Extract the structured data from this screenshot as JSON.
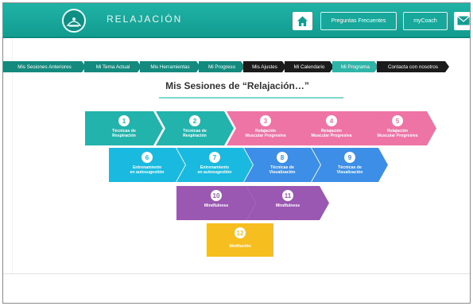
{
  "header": {
    "app_title": "RELAJACIÓN",
    "faq_label": "Preguntas Frecuentes",
    "coach_label": "myCoach",
    "colors": {
      "brand": "#17a79b"
    }
  },
  "nav": {
    "items": [
      {
        "label": "Mis Sesiones Anteriores",
        "style": "teal"
      },
      {
        "label": "Mi Tema Actual",
        "style": "teal"
      },
      {
        "label": "Mis Herramientas",
        "style": "teal"
      },
      {
        "label": "Mi Progreso",
        "style": "teal"
      },
      {
        "label": "Mis Ajustes",
        "style": "dark"
      },
      {
        "label": "Mi Calendario",
        "style": "dark"
      },
      {
        "label": "Mi Programa",
        "style": "active"
      },
      {
        "label": "Contacta con nosotros",
        "style": "dark"
      }
    ]
  },
  "main": {
    "title": "Mis Sesiones de “Relajación…”"
  },
  "steps": [
    {
      "n": "1",
      "label": "Técnicas de\nRespiración",
      "color": "teal"
    },
    {
      "n": "2",
      "label": "Técnicas de\nRespiración",
      "color": "teal"
    },
    {
      "n": "3",
      "label": "Relajación\nMuscular Progresiva",
      "color": "pink"
    },
    {
      "n": "4",
      "label": "Relajación\nMuscular Progresiva",
      "color": "pink"
    },
    {
      "n": "5",
      "label": "Relajación\nMuscular Progresiva",
      "color": "pink"
    },
    {
      "n": "6",
      "label": "Entrenamiento\nen autosugestión",
      "color": "cyan"
    },
    {
      "n": "7",
      "label": "Entrenamiento\nen autosugestión",
      "color": "cyan"
    },
    {
      "n": "8",
      "label": "Técnicas de\nVisualización",
      "color": "blue"
    },
    {
      "n": "9",
      "label": "Técnicas de\nVisualización",
      "color": "blue"
    },
    {
      "n": "10",
      "label": "Mindfulness",
      "color": "purple"
    },
    {
      "n": "11",
      "label": "Mindfulness",
      "color": "purple"
    },
    {
      "n": "12",
      "label": "Meditación",
      "color": "yellow"
    }
  ]
}
